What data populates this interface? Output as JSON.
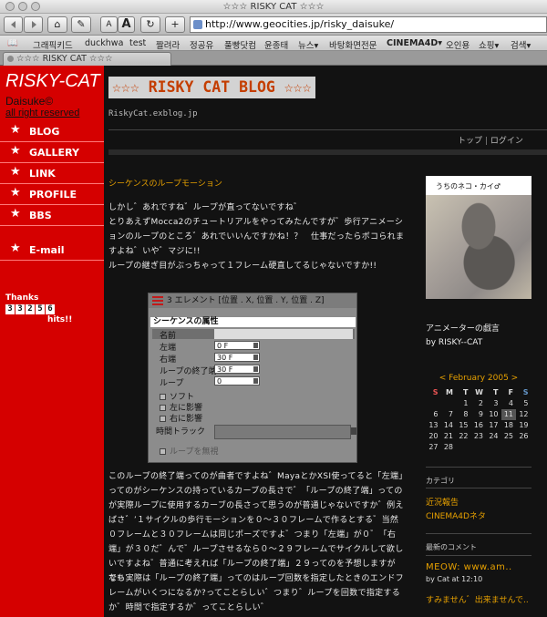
{
  "window": {
    "title": "☆☆☆ RISKY CAT ☆☆☆"
  },
  "toolbar": {
    "back_icon": "back-icon",
    "forward_icon": "forward-icon",
    "home_label": "⌂",
    "edit_label": "✎",
    "text_smaller": "A",
    "text_bigger": "A",
    "reload_label": "↻",
    "add_label": "+",
    "url": "http://www.geocities.jp/risky_daisuke/"
  },
  "bookmarks": [
    "그래픽키드",
    "duckhwa",
    "test",
    "짤려라",
    "정공유",
    "풀빵닷컴",
    "윤종태",
    "뉴스▾",
    "바탕화면전문",
    "CINEMA4D▾",
    "오인용",
    "쇼핑▾",
    "검색▾"
  ],
  "tab": {
    "label": "☆☆☆ RISKY CAT ☆☆☆"
  },
  "sidebar": {
    "site_name": "RISKY-CAT",
    "author": "Daisuke©",
    "copyright": "all right reserved",
    "nav": [
      {
        "label": "BLOG"
      },
      {
        "label": "GALLERY"
      },
      {
        "label": "LINK"
      },
      {
        "label": "PROFILE"
      },
      {
        "label": "BBS"
      },
      {
        "label": "E-mail"
      }
    ],
    "thanks": "Thanks",
    "counter": [
      "3",
      "3",
      "2",
      "5",
      "6"
    ],
    "hits": "hits!!"
  },
  "main": {
    "blog_title": "☆☆☆ RISKY CAT BLOG ☆☆☆",
    "blog_url": "RiskyCat.exblog.jp",
    "login": {
      "top": "トップ",
      "sep": "|",
      "login": "ログイン"
    },
    "post_title": "シーケンスのループモーション",
    "paragraph1": "しかし゛あれですね゛ループが直ってないですね゛",
    "paragraph2": "とりあえずMocca2のチュートリアルをやってみたんですが゛歩行アニメーションのループのところ゛あれでいいんですかね！？　仕事だったらボコられますよね゛いや゛マジに!!",
    "paragraph3": "ループの継ぎ目がぶっちゃって１フレーム硬直してるじゃないですか!!",
    "paragraph4": "このループの終了端ってのが曲者ですよね゛MayaとかXSI使ってると「左端」ってのがシーケンスの持っているカーブの長さで゛「ループの終了端」ってのが実際ループに使用するカーブの長さって思うのが普通じゃないですか゛例えばさ゛’１サイクルの歩行モーションを０～３０フレームで作るとする゛当然０フレームと３０フレームは同じポーズですよ゛つまり「左端」が０゛「右端」が３０だ゛んで゛ループさせるなら０～２９フレームでサイクルして欲しいですよね゛普通に考えれば「ループの終了端」２９ってのを予想しますがな!!",
    "paragraph5": "でも実際は「ループの終了端」ってのはループ回数を指定したときのエンドフレームがいくつになるか?ってことらしい゛つまり゛ループを回数で指定するか゛時間で指定するか゛ってことらしい゛"
  },
  "dialog": {
    "title": "3 エレメント [位置 . X, 位置 . Y, 位置 . Z]",
    "section": "シーケンスの属性",
    "name_label": "名前",
    "rows": [
      {
        "label": "左端",
        "value": "0 F"
      },
      {
        "label": "右端",
        "value": "30 F"
      },
      {
        "label": "ループの終了端",
        "value": "30 F"
      },
      {
        "label": "ループ",
        "value": "0"
      }
    ],
    "checks": [
      "ソフト",
      "左に影響",
      "右に影響"
    ],
    "track_label": "時間トラック",
    "disable_loop": "ループを無視"
  },
  "right": {
    "photo_caption": "うちのネコ・カイ♂",
    "profile_line1": "アニメーターの戯言",
    "profile_line2": "by RISKY--CAT",
    "calendar_header": "< February 2005 >",
    "dow": [
      "S",
      "M",
      "T",
      "W",
      "T",
      "F",
      "S"
    ],
    "weeks": [
      [
        "",
        "",
        "1",
        "2",
        "3",
        "4",
        "5"
      ],
      [
        "6",
        "7",
        "8",
        "9",
        "10",
        "11",
        "12"
      ],
      [
        "13",
        "14",
        "15",
        "16",
        "17",
        "18",
        "19"
      ],
      [
        "20",
        "21",
        "22",
        "23",
        "24",
        "25",
        "26"
      ],
      [
        "27",
        "28",
        "",
        "",
        "",
        "",
        ""
      ]
    ],
    "today": "11",
    "category_heading": "カテゴリ",
    "categories": [
      "近況報告",
      "CINEMA4Dネタ"
    ],
    "recent_heading": "最新のコメント",
    "recent1": "MEOW: www.am..",
    "recent1_by": "by Cat at 12:10",
    "recent2": "すみません゛出来ませんで..",
    "colors": {
      "sidebar": "#d50000",
      "accent": "#e6a000",
      "background": "#121212"
    }
  }
}
